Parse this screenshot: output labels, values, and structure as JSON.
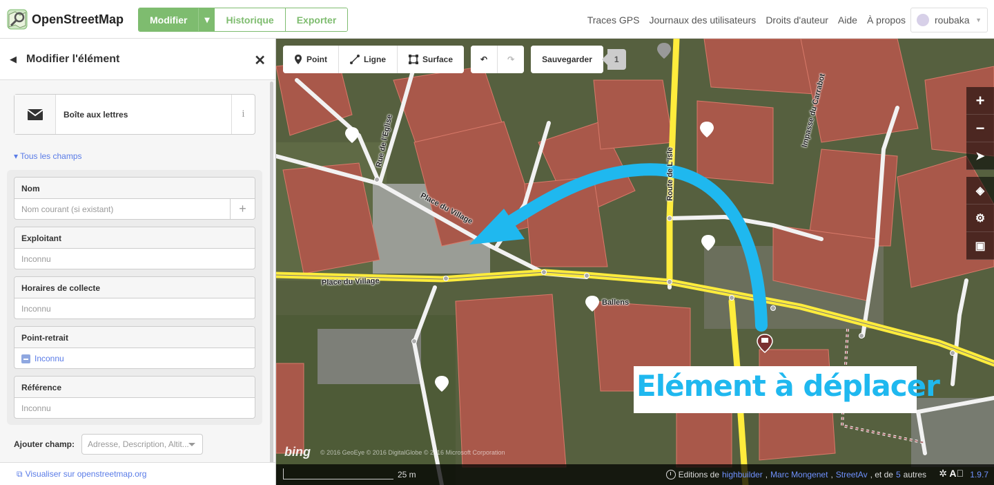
{
  "app": {
    "logo_text": "OpenStreetMap"
  },
  "tabs": {
    "edit": "Modifier",
    "history": "Historique",
    "export": "Exporter"
  },
  "nav": {
    "gps": "Traces GPS",
    "diaries": "Journaux des utilisateurs",
    "copyright": "Droits d'auteur",
    "help": "Aide",
    "about": "À propos"
  },
  "user": {
    "name": "roubaka"
  },
  "sidebar": {
    "title": "Modifier l'élément",
    "preset_label": "Boîte aux lettres",
    "info_glyph": "i",
    "all_fields": "Tous les champs",
    "fields": [
      {
        "label": "Nom",
        "placeholder": "Nom courant (si existant)"
      },
      {
        "label": "Exploitant",
        "placeholder": "Inconnu"
      },
      {
        "label": "Horaires de collecte",
        "placeholder": "Inconnu"
      },
      {
        "label": "Point-retrait",
        "value": "Inconnu"
      },
      {
        "label": "Référence",
        "placeholder": "Inconnu"
      }
    ],
    "add_field_label": "Ajouter champ:",
    "add_field_placeholder": "Adresse, Description, Altit...",
    "view_on_osm": "Visualiser sur openstreetmap.org"
  },
  "toolbar": {
    "point": "Point",
    "line": "Ligne",
    "area": "Surface",
    "save": "Sauvegarder",
    "count": "1"
  },
  "map": {
    "labels": {
      "place_village_1": "Place du Village",
      "place_village_2": "Place du Village",
      "rue_eglise": "Rue de l'Eglise",
      "route_isle": "Route de L'Isle",
      "impasse": "Impasse du Carrabot",
      "ballens": "Ballens"
    },
    "callout": "Elément à déplacer",
    "callout_color": "#1fb8ef",
    "bing": "bing",
    "bing_copy": "© 2016 GeoEye © 2016 DigitalGlobe © 2016 Microsoft Corporation",
    "scale": "25 m",
    "attribution": {
      "prefix": "Editions de",
      "user1": "highbuilder",
      "user2": "Marc Mongenet",
      "user3": "StreetAv",
      "suffix1": ", et de",
      "count": "5",
      "suffix2": "autres"
    },
    "version": "1.9.7"
  },
  "colors": {
    "accent_green": "#7ebc6f",
    "link_blue": "#597be7",
    "road_yellow": "#ffec3c"
  }
}
